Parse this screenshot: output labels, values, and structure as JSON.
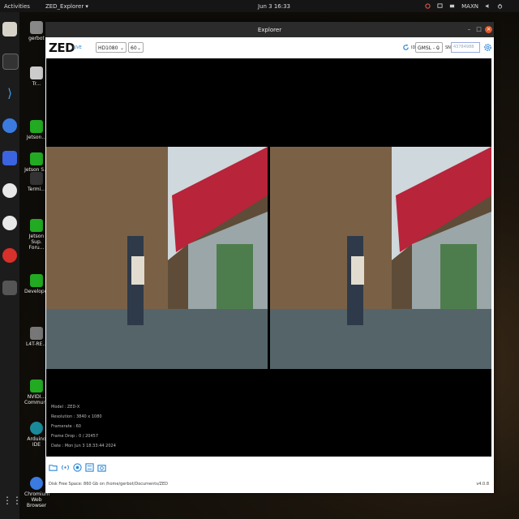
{
  "topbar": {
    "activities": "Activities",
    "app_menu": "ZED_Explorer ▾",
    "clock": "Jun 3  16:33",
    "power_mode": "MAXN"
  },
  "desktop": {
    "items": [
      {
        "label": "gerbot"
      },
      {
        "label": "Tr..."
      },
      {
        "label": "Jetson..."
      },
      {
        "label": "Jetson S..."
      },
      {
        "label": "Termi..."
      },
      {
        "label": "Jetson Sup. Foru..."
      },
      {
        "label": "Developer..."
      },
      {
        "label": "L4T-RE..."
      },
      {
        "label": "NVIDI... Commun..."
      },
      {
        "label": "Arduino IDE"
      },
      {
        "label": "Chromium Web Browser"
      }
    ]
  },
  "window": {
    "title": "Explorer",
    "controls": {
      "minimize": "–",
      "maximize": "□",
      "close": "×"
    }
  },
  "toolbar": {
    "logo": "ZED",
    "live": "LIVE",
    "resolution": "HD1080",
    "fps": "60",
    "id_label": "ID",
    "camera_select": "GMSL - 0",
    "sn_label": "SN",
    "sn_placeholder": "43784988"
  },
  "info": {
    "model": "Model : ZED-X",
    "resolution": "Resolution : 3840 x 1080",
    "framerate": "Framerate : 60",
    "frame_drop": "Frame Drop : 0 / 20457",
    "date": "Date : Mon Jun 3 18:33:44 2024"
  },
  "footer": {
    "disk": "Disk Free Space: 860 Gb  on  /home/gerbot/Documents/ZED",
    "version": "v4.0.8"
  },
  "colors": {
    "accent": "#2a86d6",
    "close": "#e0582b",
    "titlebar": "#2b2b2b"
  }
}
